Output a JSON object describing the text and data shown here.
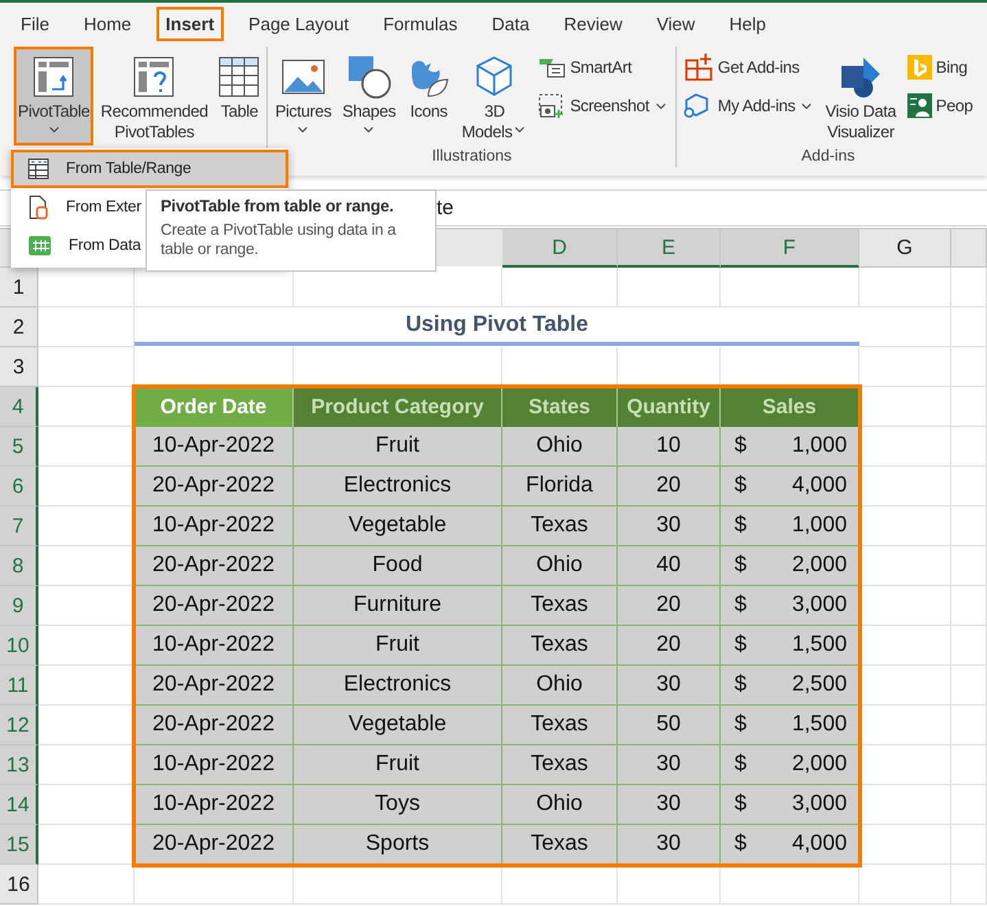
{
  "ribbon_tabs": [
    {
      "label": "File",
      "selected": false
    },
    {
      "label": "Home",
      "selected": false
    },
    {
      "label": "Insert",
      "selected": true
    },
    {
      "label": "Page Layout",
      "selected": false
    },
    {
      "label": "Formulas",
      "selected": false
    },
    {
      "label": "Data",
      "selected": false
    },
    {
      "label": "Review",
      "selected": false
    },
    {
      "label": "View",
      "selected": false
    },
    {
      "label": "Help",
      "selected": false
    }
  ],
  "ribbon": {
    "groups": [
      {
        "buttons": [
          {
            "kind": "large",
            "lines": [
              "PivotTable"
            ],
            "menu": true,
            "pressed": true
          },
          {
            "kind": "large",
            "lines": [
              "Recommended",
              "PivotTables"
            ],
            "menu": false,
            "pressed": false
          },
          {
            "kind": "large",
            "lines": [
              "Table"
            ],
            "menu": false,
            "pressed": false
          }
        ]
      },
      {
        "label": "Illustrations",
        "buttons": [
          {
            "kind": "large",
            "lines": [
              "Pictures"
            ],
            "menu": true,
            "pressed": false
          },
          {
            "kind": "large",
            "lines": [
              "Shapes"
            ],
            "menu": true,
            "pressed": false
          },
          {
            "kind": "large",
            "lines": [
              "Icons"
            ],
            "menu": false,
            "pressed": false
          },
          {
            "kind": "large",
            "lines": [
              "3D",
              "Models"
            ],
            "menu": true,
            "pressed": false
          },
          {
            "kind": "small",
            "lines": [
              "SmartArt"
            ],
            "menu": false,
            "pressed": false
          },
          {
            "kind": "small",
            "lines": [
              "Screenshot"
            ],
            "menu": true,
            "pressed": false
          }
        ]
      },
      {
        "label": "Add-ins",
        "buttons": [
          {
            "kind": "small",
            "lines": [
              "Get Add-ins"
            ],
            "menu": false,
            "pressed": false
          },
          {
            "kind": "small",
            "lines": [
              "My Add-ins"
            ],
            "menu": true,
            "pressed": false
          },
          {
            "kind": "large",
            "lines": [
              "Visio Data",
              "Visualizer"
            ],
            "menu": false,
            "pressed": false
          },
          {
            "kind": "small",
            "lines": [
              "Bing"
            ],
            "menu": false,
            "pressed": false
          },
          {
            "kind": "small",
            "lines": [
              "Peop"
            ],
            "menu": false,
            "pressed": false
          }
        ]
      }
    ]
  },
  "pivot_menu": [
    {
      "label": "From Table/Range",
      "selected": true
    },
    {
      "label": "From Exter",
      "selected": false
    },
    {
      "label": "From Data",
      "selected": false
    }
  ],
  "tooltip": {
    "title": "PivotTable from table or range.",
    "text": "Create a PivotTable using data in a table or range."
  },
  "formula_bar": {
    "value": "te"
  },
  "sheet": {
    "columns": [
      {
        "label": "D",
        "selected": true
      },
      {
        "label": "E",
        "selected": true
      },
      {
        "label": "F",
        "selected": true
      },
      {
        "label": "G",
        "selected": false
      }
    ],
    "rows": [
      {
        "label": "1",
        "selected": false
      },
      {
        "label": "2",
        "selected": false
      },
      {
        "label": "3",
        "selected": false
      },
      {
        "label": "4",
        "selected": true
      },
      {
        "label": "5",
        "selected": true
      },
      {
        "label": "6",
        "selected": true
      },
      {
        "label": "7",
        "selected": true
      },
      {
        "label": "8",
        "selected": true
      },
      {
        "label": "9",
        "selected": true
      },
      {
        "label": "10",
        "selected": true
      },
      {
        "label": "11",
        "selected": true
      },
      {
        "label": "12",
        "selected": true
      },
      {
        "label": "13",
        "selected": true
      },
      {
        "label": "14",
        "selected": true
      },
      {
        "label": "15",
        "selected": true
      },
      {
        "label": "16",
        "selected": false
      }
    ],
    "title": "Using Pivot Table",
    "table": {
      "columns": [
        {
          "label": "Order Date",
          "active": true
        },
        {
          "label": "Product Category",
          "active": false
        },
        {
          "label": "States",
          "active": false
        },
        {
          "label": "Quantity",
          "active": false
        },
        {
          "label": "Sales",
          "active": false
        }
      ],
      "rows": [
        {
          "order_date": "10-Apr-2022",
          "category": "Fruit",
          "state": "Ohio",
          "quantity": "10",
          "currency": "$",
          "sales": "1,000"
        },
        {
          "order_date": "20-Apr-2022",
          "category": "Electronics",
          "state": "Florida",
          "quantity": "20",
          "currency": "$",
          "sales": "4,000"
        },
        {
          "order_date": "10-Apr-2022",
          "category": "Vegetable",
          "state": "Texas",
          "quantity": "30",
          "currency": "$",
          "sales": "1,000"
        },
        {
          "order_date": "20-Apr-2022",
          "category": "Food",
          "state": "Ohio",
          "quantity": "40",
          "currency": "$",
          "sales": "2,000"
        },
        {
          "order_date": "20-Apr-2022",
          "category": "Furniture",
          "state": "Texas",
          "quantity": "20",
          "currency": "$",
          "sales": "3,000"
        },
        {
          "order_date": "10-Apr-2022",
          "category": "Fruit",
          "state": "Texas",
          "quantity": "20",
          "currency": "$",
          "sales": "1,500"
        },
        {
          "order_date": "20-Apr-2022",
          "category": "Electronics",
          "state": "Ohio",
          "quantity": "30",
          "currency": "$",
          "sales": "2,500"
        },
        {
          "order_date": "20-Apr-2022",
          "category": "Vegetable",
          "state": "Texas",
          "quantity": "50",
          "currency": "$",
          "sales": "1,500"
        },
        {
          "order_date": "10-Apr-2022",
          "category": "Fruit",
          "state": "Texas",
          "quantity": "30",
          "currency": "$",
          "sales": "2,000"
        },
        {
          "order_date": "10-Apr-2022",
          "category": "Toys",
          "state": "Ohio",
          "quantity": "30",
          "currency": "$",
          "sales": "3,000"
        },
        {
          "order_date": "20-Apr-2022",
          "category": "Sports",
          "state": "Texas",
          "quantity": "30",
          "currency": "$",
          "sales": "4,000"
        }
      ]
    }
  }
}
